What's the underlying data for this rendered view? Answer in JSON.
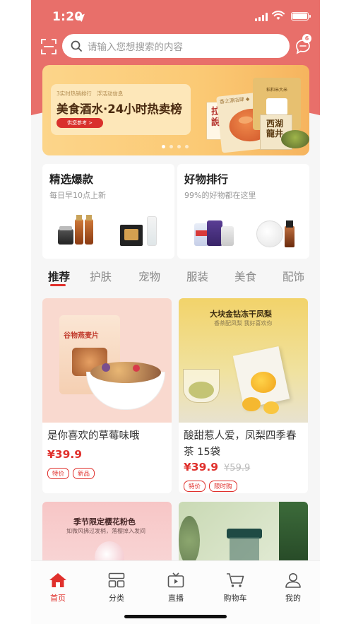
{
  "status_bar": {
    "time": "1:20"
  },
  "search": {
    "placeholder": "请输入您想搜索的内容",
    "message_badge": "6"
  },
  "banner": {
    "sub_left": "3实时热销排行",
    "sub_right": "浮活动信息",
    "title": "美食酒水·24小时热卖榜",
    "button": "供您参考 >",
    "image_texts": {
      "box1": "拉面說",
      "box2": "西湖龍井",
      "pack": "稻和米大米"
    },
    "dot_count": 4,
    "active_dot": 1
  },
  "promo": {
    "left": {
      "title": "精选爆款",
      "subtitle": "每日早10点上新"
    },
    "right": {
      "title": "好物排行",
      "subtitle": "99%的好物都在这里"
    }
  },
  "tabs": [
    "推荐",
    "护肤",
    "宠物",
    "服装",
    "美食",
    "配饰"
  ],
  "products": [
    {
      "name": "是你喜欢的草莓味哦",
      "price": "¥39.9",
      "old_price": "",
      "tags": [
        "特价",
        "新品"
      ],
      "image_text": "谷物燕麦片"
    },
    {
      "name": "酸甜惹人爱，凤梨四季春茶 15袋",
      "price": "¥39.9",
      "old_price": "¥59.9",
      "tags": [
        "特价",
        "限时购"
      ],
      "image_title": "大块金钻冻干凤梨",
      "image_sub": "香茶配凤梨 我好喜欢你"
    },
    {
      "name": "",
      "image_title": "季节限定樱花粉色",
      "image_sub": "如微风拂过发梢，落樱掉入发间"
    },
    {
      "name": ""
    }
  ],
  "tabbar": [
    {
      "label": "首页",
      "icon": "home-icon",
      "active": true
    },
    {
      "label": "分类",
      "icon": "category-icon",
      "active": false
    },
    {
      "label": "直播",
      "icon": "tv-icon",
      "active": false
    },
    {
      "label": "购物车",
      "icon": "cart-icon",
      "active": false
    },
    {
      "label": "我的",
      "icon": "profile-icon",
      "active": false
    }
  ],
  "colors": {
    "brand": "#e86f6a",
    "accent": "#e0302c",
    "banner": "#fbc974"
  }
}
